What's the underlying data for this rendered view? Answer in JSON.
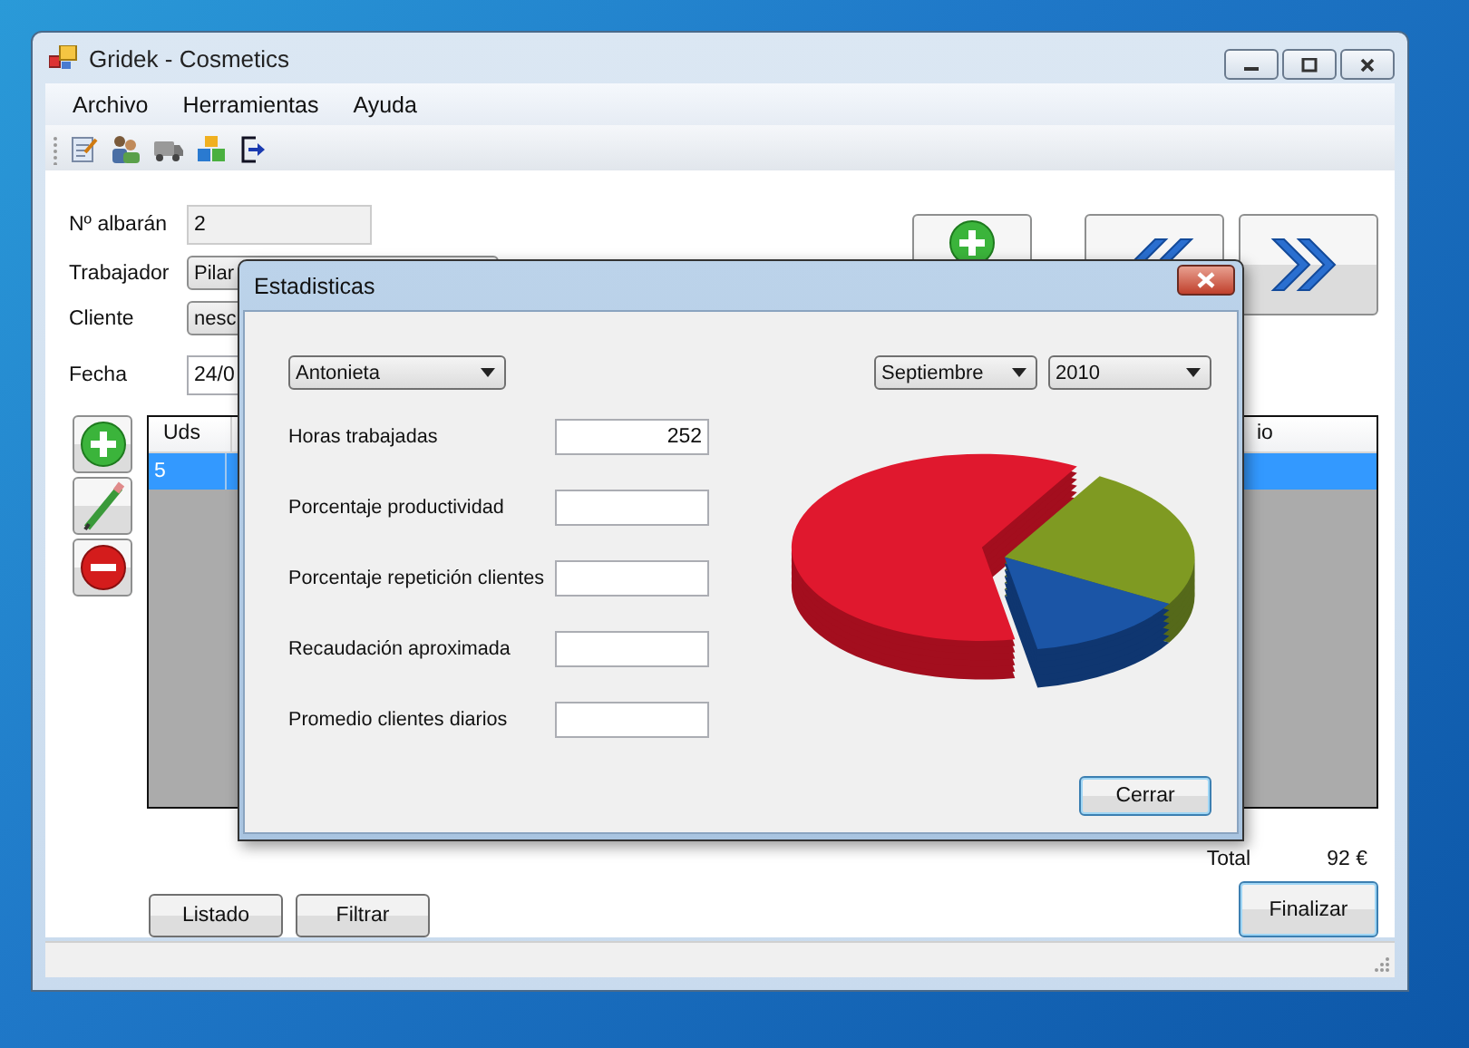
{
  "main_window": {
    "title": "Gridek - Cosmetics",
    "menu": [
      {
        "label": "Archivo"
      },
      {
        "label": "Herramientas"
      },
      {
        "label": "Ayuda"
      }
    ],
    "form": [
      {
        "label": "Nº albarán",
        "value": "2",
        "kind": "readonly"
      },
      {
        "label": "Trabajador",
        "value": "Pilar",
        "kind": "combo"
      },
      {
        "label": "Cliente",
        "value": "nesc",
        "kind": "combo"
      },
      {
        "label": "Fecha",
        "value": "24/0",
        "kind": "date"
      }
    ],
    "table": {
      "columns": [
        {
          "label": "Uds"
        },
        {
          "label": "io"
        }
      ],
      "rows": [
        {
          "cells": [
            "5"
          ],
          "selected": true
        }
      ]
    },
    "total": {
      "label": "Total",
      "value": "92 €"
    },
    "buttons_left": [
      "Listado",
      "Filtrar"
    ],
    "finish_button": "Finalizar"
  },
  "dialog": {
    "title": "Estadisticas",
    "worker": "Antonieta",
    "month": "Septiembre",
    "year": "2010",
    "fields": [
      {
        "label": "Horas trabajadas",
        "value": "252"
      },
      {
        "label": "Porcentaje  productividad"
      },
      {
        "label": "Porcentaje repetición clientes"
      },
      {
        "label": "Recaudación aproximada"
      },
      {
        "label": "Promedio clientes diarios"
      }
    ],
    "close_button": "Cerrar"
  }
}
